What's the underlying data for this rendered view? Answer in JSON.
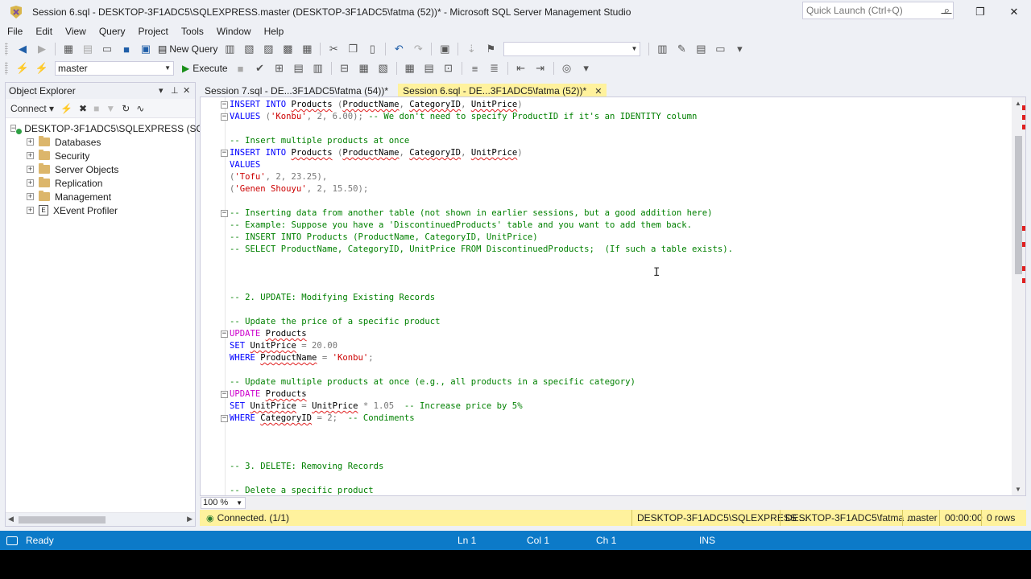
{
  "window": {
    "title": "Session 6.sql - DESKTOP-3F1ADC5\\SQLEXPRESS.master (DESKTOP-3F1ADC5\\fatma (52))* - Microsoft SQL Server Management Studio",
    "quick_launch_placeholder": "Quick Launch (Ctrl+Q)"
  },
  "menu": [
    "File",
    "Edit",
    "View",
    "Query",
    "Project",
    "Tools",
    "Window",
    "Help"
  ],
  "toolbar": {
    "new_query_label": "New Query",
    "database_selected": "master",
    "execute_label": "Execute"
  },
  "object_explorer": {
    "title": "Object Explorer",
    "connect_label": "Connect",
    "server_node": "DESKTOP-3F1ADC5\\SQLEXPRESS (SQL",
    "nodes": [
      "Databases",
      "Security",
      "Server Objects",
      "Replication",
      "Management",
      "XEvent Profiler"
    ]
  },
  "tabs": [
    {
      "label": "Session 7.sql - DE...3F1ADC5\\fatma (54))*",
      "active": false
    },
    {
      "label": "Session 6.sql - DE...3F1ADC5\\fatma (52))*",
      "active": true
    }
  ],
  "editor": {
    "zoom": "100 %",
    "lines": [
      {
        "tokens": [
          [
            "kw",
            "INSERT INTO "
          ],
          [
            "id",
            "Products"
          ],
          [
            "gy",
            " ("
          ],
          [
            "id",
            "ProductName"
          ],
          [
            "gy",
            ", "
          ],
          [
            "id",
            "CategoryID"
          ],
          [
            "gy",
            ", "
          ],
          [
            "id",
            "UnitPrice"
          ],
          [
            "gy",
            ")"
          ]
        ]
      },
      {
        "tokens": [
          [
            "kw",
            "VALUES "
          ],
          [
            "gy",
            "("
          ],
          [
            "str",
            "'Konbu'"
          ],
          [
            "gy",
            ", 2, 6.00); "
          ],
          [
            "cm",
            "-- We don't need to specify ProductID if it's an IDENTITY column"
          ]
        ]
      },
      {
        "tokens": []
      },
      {
        "tokens": [
          [
            "cm",
            "-- Insert multiple products at once"
          ]
        ]
      },
      {
        "tokens": [
          [
            "kw",
            "INSERT INTO "
          ],
          [
            "id",
            "Products"
          ],
          [
            "gy",
            " ("
          ],
          [
            "id",
            "ProductName"
          ],
          [
            "gy",
            ", "
          ],
          [
            "id",
            "CategoryID"
          ],
          [
            "gy",
            ", "
          ],
          [
            "id",
            "UnitPrice"
          ],
          [
            "gy",
            ")"
          ]
        ]
      },
      {
        "tokens": [
          [
            "kw",
            "VALUES"
          ]
        ]
      },
      {
        "tokens": [
          [
            "gy",
            "("
          ],
          [
            "str",
            "'Tofu'"
          ],
          [
            "gy",
            ", 2, 23.25),"
          ]
        ]
      },
      {
        "tokens": [
          [
            "gy",
            "("
          ],
          [
            "str",
            "'Genen Shouyu'"
          ],
          [
            "gy",
            ", 2, 15.50);"
          ]
        ]
      },
      {
        "tokens": []
      },
      {
        "tokens": [
          [
            "cm",
            "-- Inserting data from another table (not shown in earlier sessions, but a good addition here)"
          ]
        ]
      },
      {
        "tokens": [
          [
            "cm",
            "-- Example: Suppose you have a 'DiscontinuedProducts' table and you want to add them back."
          ]
        ]
      },
      {
        "tokens": [
          [
            "cm",
            "-- INSERT INTO Products (ProductName, CategoryID, UnitPrice)"
          ]
        ]
      },
      {
        "tokens": [
          [
            "cm",
            "-- SELECT ProductName, CategoryID, UnitPrice FROM DiscontinuedProducts;  (If such a table exists)."
          ]
        ]
      },
      {
        "tokens": []
      },
      {
        "tokens": []
      },
      {
        "tokens": []
      },
      {
        "tokens": [
          [
            "cm",
            "-- 2. UPDATE: Modifying Existing Records"
          ]
        ]
      },
      {
        "tokens": []
      },
      {
        "tokens": [
          [
            "cm",
            "-- Update the price of a specific product"
          ]
        ]
      },
      {
        "tokens": [
          [
            "pk",
            "UPDATE "
          ],
          [
            "id",
            "Products"
          ]
        ]
      },
      {
        "tokens": [
          [
            "kw",
            "SET "
          ],
          [
            "id",
            "UnitPrice"
          ],
          [
            "gy",
            " = 20.00"
          ]
        ]
      },
      {
        "tokens": [
          [
            "kw",
            "WHERE "
          ],
          [
            "id",
            "ProductName"
          ],
          [
            "gy",
            " = "
          ],
          [
            "str",
            "'Konbu'"
          ],
          [
            "gy",
            ";"
          ]
        ]
      },
      {
        "tokens": []
      },
      {
        "tokens": [
          [
            "cm",
            "-- Update multiple products at once (e.g., all products in a specific category)"
          ]
        ]
      },
      {
        "tokens": [
          [
            "pk",
            "UPDATE "
          ],
          [
            "id",
            "Products"
          ]
        ]
      },
      {
        "tokens": [
          [
            "kw",
            "SET "
          ],
          [
            "id",
            "UnitPrice"
          ],
          [
            "gy",
            " = "
          ],
          [
            "id",
            "UnitPrice"
          ],
          [
            "gy",
            " * 1.05  "
          ],
          [
            "cm",
            "-- Increase price by 5%"
          ]
        ]
      },
      {
        "tokens": [
          [
            "kw",
            "WHERE "
          ],
          [
            "id",
            "CategoryID"
          ],
          [
            "gy",
            " = 2;  "
          ],
          [
            "cm",
            "-- Condiments"
          ]
        ]
      },
      {
        "tokens": []
      },
      {
        "tokens": []
      },
      {
        "tokens": []
      },
      {
        "tokens": [
          [
            "cm",
            "-- 3. DELETE: Removing Records"
          ]
        ]
      },
      {
        "tokens": []
      },
      {
        "tokens": [
          [
            "cm",
            "-- Delete a specific product"
          ]
        ]
      }
    ]
  },
  "query_status": {
    "message": "Connected. (1/1)",
    "server": "DESKTOP-3F1ADC5\\SQLEXPRESS ...",
    "user": "DESKTOP-3F1ADC5\\fatma ...",
    "database": "master",
    "elapsed": "00:00:00",
    "rows": "0 rows"
  },
  "status_bar": {
    "state": "Ready",
    "ln": "Ln 1",
    "col": "Col 1",
    "ch": "Ch 1",
    "mode": "INS"
  },
  "colors": {
    "status_bar": "#0c7ac8",
    "active_tab": "#fff29d",
    "keyword": "#0000ff",
    "comment": "#008000",
    "string": "#cc0000"
  }
}
